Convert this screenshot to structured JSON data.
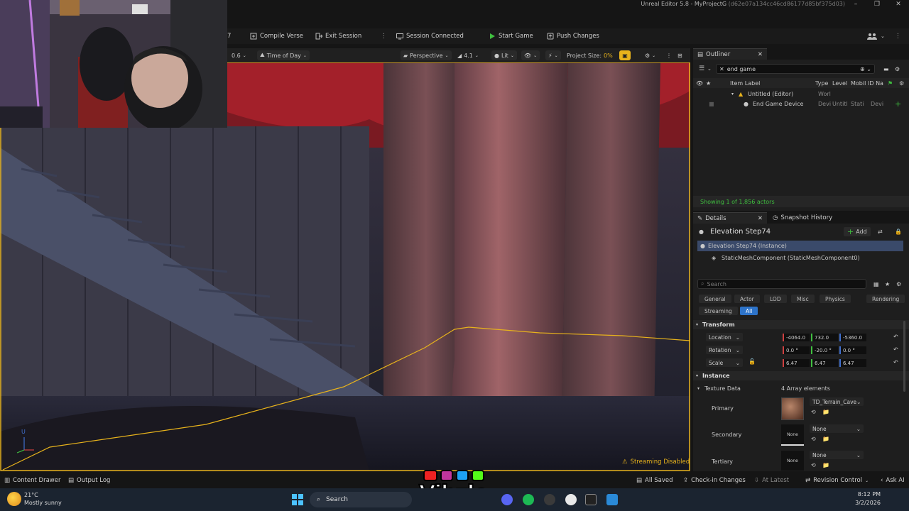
{
  "window": {
    "title": "Unreal Editor 5.8 - MyProjectG",
    "hash": "(d62e07a134cc46cd86177d85bf375d03)",
    "controls": [
      "–",
      "❐",
      "✕"
    ]
  },
  "toolbar": {
    "compile_verse": "Compile Verse",
    "exit_session": "Exit Session",
    "session_connected": "Session Connected",
    "start_game": "Start Game",
    "push_changes": "Push Changes"
  },
  "viewport_bar": {
    "snap_value": "0.6",
    "time_of_day": "Time of Day",
    "perspective": "Perspective",
    "fov": "4.1",
    "lit": "Lit",
    "project_size_label": "Project Size:",
    "project_size_value": "0%"
  },
  "viewport": {
    "streaming_disabled": "Streaming Disabled",
    "axis_label": "U"
  },
  "outliner": {
    "tab": "Outliner",
    "search_value": "end game",
    "columns": [
      "Item Label",
      "Type",
      "Level",
      "Mobil",
      "ID Na"
    ],
    "rows": [
      {
        "label": "Untitled (Editor)",
        "type": "Worl",
        "level": "",
        "mob": "",
        "id": ""
      },
      {
        "label": "End Game Device",
        "type": "Devi",
        "level": "Untitl",
        "mob": "Stati",
        "id": "Devi"
      }
    ],
    "status": "Showing 1 of 1,856 actors"
  },
  "details": {
    "tab": "Details",
    "tab2": "Snapshot History",
    "actor_name": "Elevation Step74",
    "add_label": "Add",
    "instance_label": "Elevation Step74 (Instance)",
    "component_label": "StaticMeshComponent (StaticMeshComponent0)",
    "search_placeholder": "Search",
    "categories": [
      "General",
      "Actor",
      "LOD",
      "Misc",
      "Physics",
      "Rendering"
    ],
    "categories2": [
      "Streaming",
      "All"
    ],
    "transform_header": "Transform",
    "location_label": "Location",
    "location": [
      "-4064.0",
      "732.0",
      "-5360.0"
    ],
    "rotation_label": "Rotation",
    "rotation": [
      "0.0 °",
      "-20.0 °",
      "0.0 °"
    ],
    "scale_label": "Scale",
    "scale": [
      "6.47",
      "6.47",
      "6.47"
    ],
    "instance_header": "Instance",
    "texture_data_label": "Texture Data",
    "texture_data_value": "4 Array elements",
    "primary_label": "Primary",
    "primary_value": "TD_Terrain_Cave",
    "secondary_label": "Secondary",
    "secondary_value": "None",
    "tertiary_label": "Tertiary",
    "tertiary_value": "None",
    "thumb_none": "None"
  },
  "statusbar": {
    "content_drawer": "Content Drawer",
    "output_log": "Output Log",
    "all_saved": "All Saved",
    "check_in": "Check-in Changes",
    "at_latest": "At Latest",
    "revision_control": "Revision Control",
    "ask_ai": "Ask AI"
  },
  "taskbar": {
    "temperature": "21°C",
    "weather": "Mostly sunny",
    "search": "Search",
    "time": "8:12 PM",
    "date": "3/2/2026"
  },
  "overlay": {
    "brand": "Vibzlo"
  },
  "colors": {
    "accent_yellow": "#e8b31c",
    "selection_blue": "#2d73c9",
    "x_axis": "#d04040",
    "y_axis": "#40c040",
    "z_axis": "#4070d0"
  }
}
